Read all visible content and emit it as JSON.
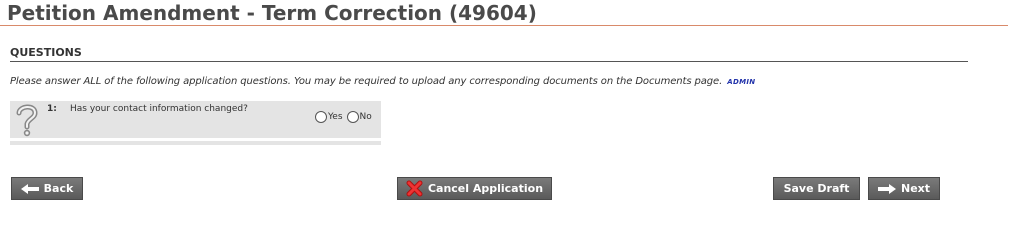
{
  "page": {
    "title": "Petition Amendment - Term Correction (49604)"
  },
  "questions_section": {
    "heading": "QUESTIONS",
    "instructions": "Please answer ALL of the following application questions. You may be required to upload any corresponding documents on the Documents page.",
    "admin_link": "ADMIN"
  },
  "questions": [
    {
      "number": "1:",
      "text": "Has your contact information changed?",
      "options": [
        "Yes",
        "No"
      ],
      "icon": "question-mark-icon"
    }
  ],
  "buttons": {
    "back": "Back",
    "cancel": "Cancel Application",
    "save_draft": "Save Draft",
    "next": "Next"
  },
  "colors": {
    "title_rule": "#d98a6a",
    "button_bg": "#666666",
    "admin_link": "#2233aa",
    "question_bg": "#e4e4e4"
  }
}
